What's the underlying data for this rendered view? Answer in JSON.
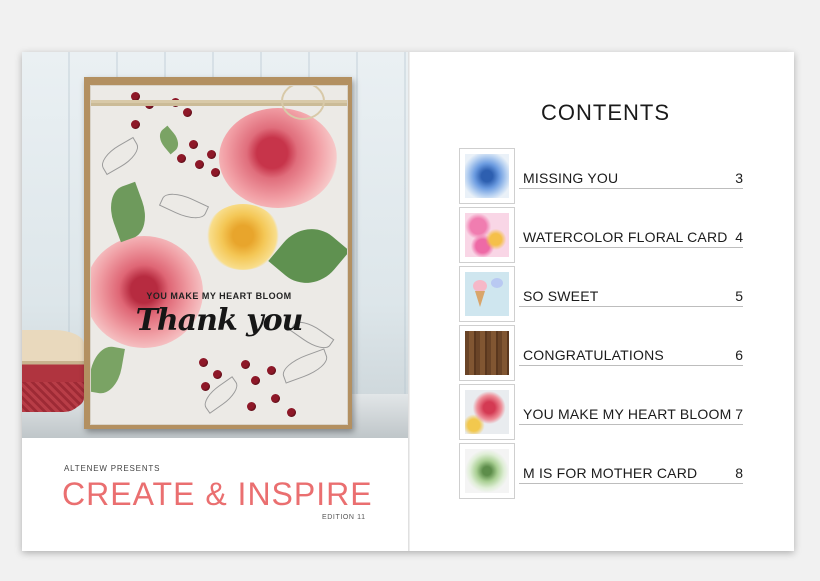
{
  "cover": {
    "presenter": "ALTENEW PRESENTS",
    "title": "CREATE & INSPIRE",
    "edition": "EDITION 11",
    "title_color": "#ea6f70",
    "card_sentiment_small": "YOU MAKE MY HEART BLOOM",
    "card_sentiment_large": "Thank you"
  },
  "contents": {
    "heading": "CONTENTS",
    "items": [
      {
        "title": "MISSING YOU",
        "page": "3",
        "thumb": "blue-flower"
      },
      {
        "title": "WATERCOLOR FLORAL CARD",
        "page": "4",
        "thumb": "pink-watercolor"
      },
      {
        "title": "SO SWEET",
        "page": "5",
        "thumb": "ice-cream"
      },
      {
        "title": "CONGRATULATIONS",
        "page": "6",
        "thumb": "wood-grain"
      },
      {
        "title": "YOU MAKE MY HEART BLOOM",
        "page": "7",
        "thumb": "pink-peony"
      },
      {
        "title": "M IS FOR MOTHER CARD",
        "page": "8",
        "thumb": "green-flower"
      }
    ]
  }
}
